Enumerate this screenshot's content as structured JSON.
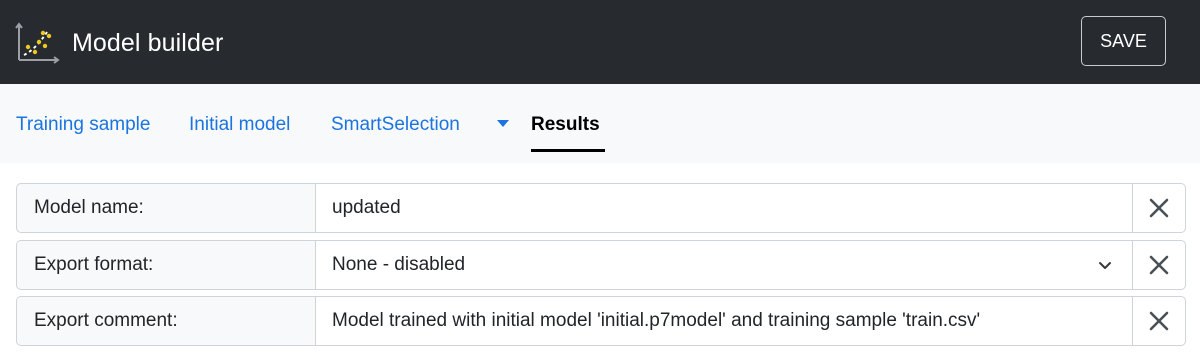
{
  "header": {
    "title": "Model builder",
    "logo_icon": "scatter-chart-icon",
    "save_label": "SAVE",
    "background": "#272b30"
  },
  "tabs": [
    {
      "label": "Training sample",
      "active": false
    },
    {
      "label": "Initial model",
      "active": false
    },
    {
      "label": "SmartSelection",
      "active": false,
      "has_dropdown": true
    },
    {
      "label": "Results",
      "active": true
    }
  ],
  "form": {
    "rows": [
      {
        "label": "Model name:",
        "value": "updated",
        "type": "text"
      },
      {
        "label": "Export format:",
        "value": "None - disabled",
        "type": "select"
      },
      {
        "label": "Export comment:",
        "value": "Model trained with initial model 'initial.p7model' and training sample 'train.csv'",
        "type": "text"
      }
    ]
  },
  "colors": {
    "link": "#1b74e0",
    "active_tab": "#000000",
    "border": "#ced4da",
    "logo_dots": "#f0c81e"
  }
}
